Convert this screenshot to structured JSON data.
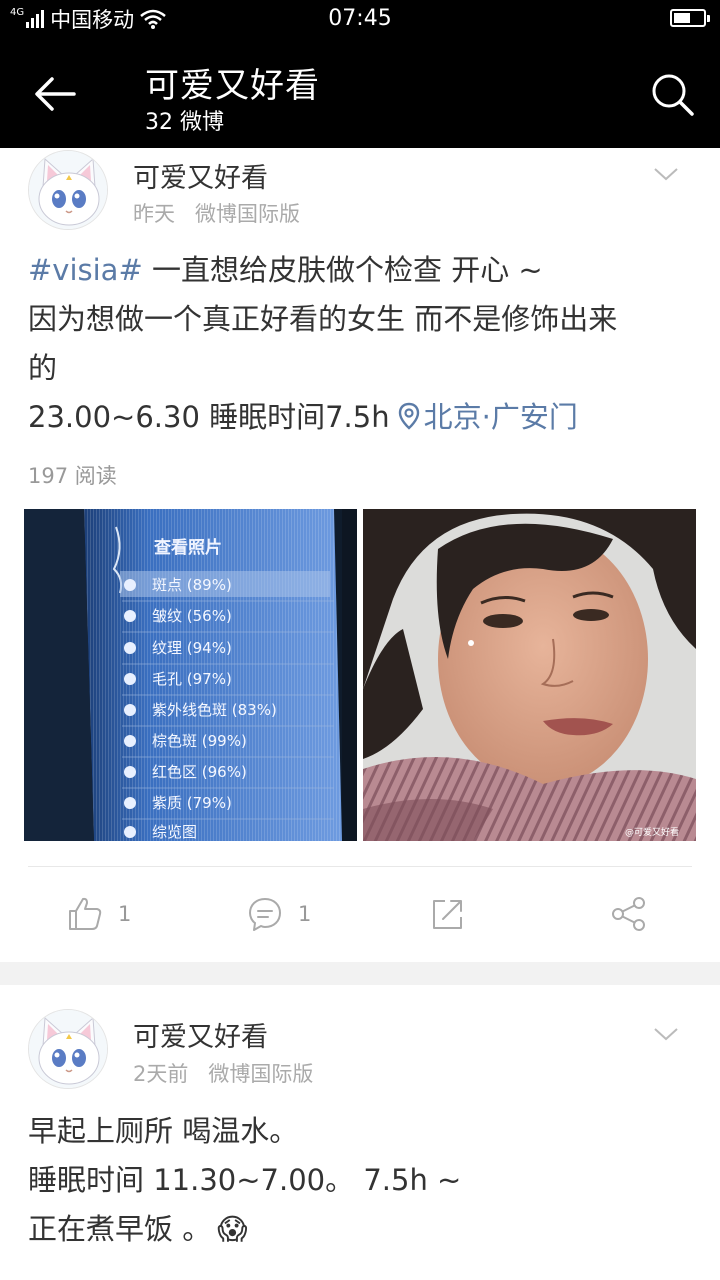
{
  "status_bar": {
    "network_type": "4G",
    "carrier": "中国移动",
    "time": "07:45",
    "wifi_icon": "wifi-icon",
    "battery_icon": "battery-icon"
  },
  "nav": {
    "back_icon": "arrow-left-icon",
    "title": "可爱又好看",
    "subtitle": "32 微博",
    "search_icon": "search-icon"
  },
  "posts": [
    {
      "username": "可爱又好看",
      "time": "昨天",
      "source": "微博国际版",
      "tag": "#visia#",
      "line1": " 一直想给皮肤做个检查 开心 ~",
      "line2": "因为想做一个真正好看的女生 而不是修饰出来",
      "line3": "的",
      "line4": "23.00~6.30 睡眠时间7.5h",
      "location": "北京·广安门",
      "read_count": "197 阅读",
      "photo1": {
        "header": "查看照片",
        "items": [
          "斑点 (89%)",
          "皱纹 (56%)",
          "纹理 (94%)",
          "毛孔 (97%)",
          "紫外线色斑 (83%)",
          "棕色斑 (99%)",
          "红色区 (96%)",
          "紫质 (79%)",
          "综览图"
        ]
      },
      "photo2": {
        "watermark": "@可爱又好看"
      },
      "likes": "1",
      "comments": "1"
    },
    {
      "username": "可爱又好看",
      "time": "2天前",
      "source": "微博国际版",
      "line1": "早起上厕所 喝温水。",
      "line2": "睡眠时间 11.30~7.00。 7.5h ~",
      "line3": "正在煮早饭 。",
      "emoji": "😱"
    }
  ],
  "colors": {
    "link": "#5b7ba7",
    "meta": "#aaaaaa",
    "background": "#f2f2f2"
  }
}
